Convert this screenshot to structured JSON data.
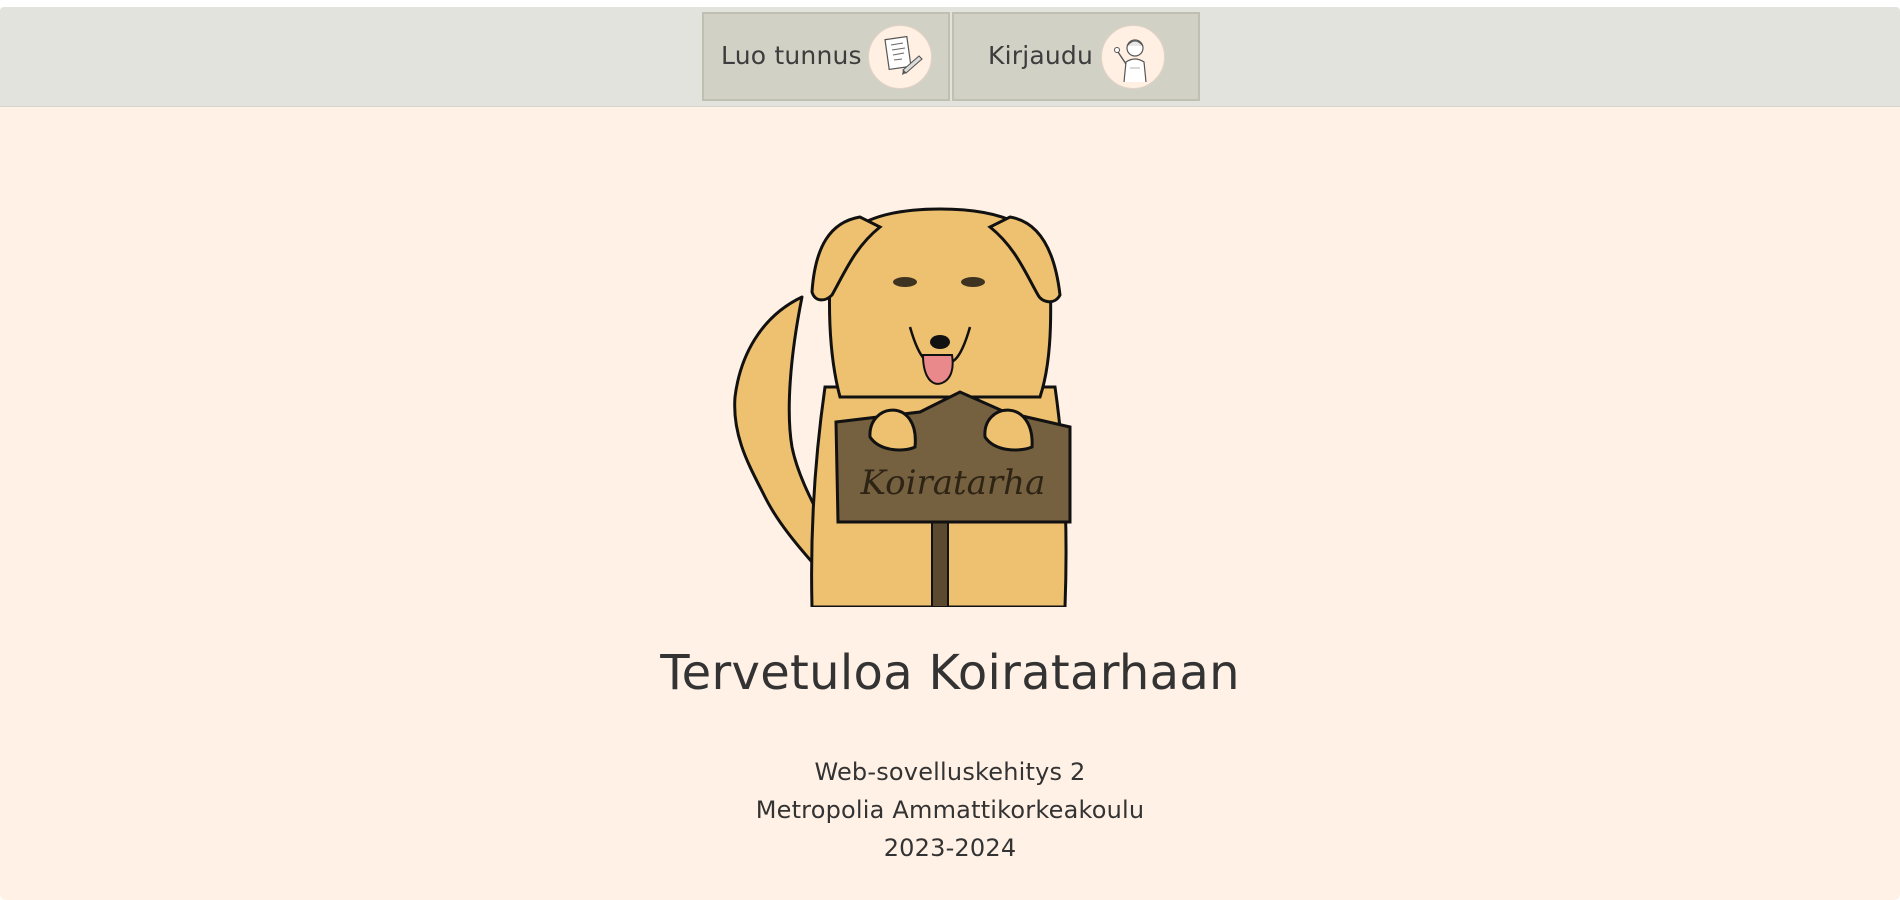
{
  "navbar": {
    "signup": {
      "label": "Luo tunnus",
      "icon": "signup-form-icon"
    },
    "login": {
      "label": "Kirjaudu",
      "icon": "waving-person-icon"
    }
  },
  "hero": {
    "image": "dog-holding-sign-illustration",
    "sign_text": "Koiratarha",
    "title": "Tervetuloa Koiratarhaan"
  },
  "info": {
    "course": "Web-sovelluskehitys 2",
    "school": "Metropolia Ammattikorkeakoulu",
    "year": "2023-2024"
  },
  "colors": {
    "background": "#fff1e6",
    "navbar": "#e3e3de",
    "button": "#d1d1c6",
    "text": "#333333",
    "dog_fur": "#eec170",
    "sign": "#75603f"
  }
}
